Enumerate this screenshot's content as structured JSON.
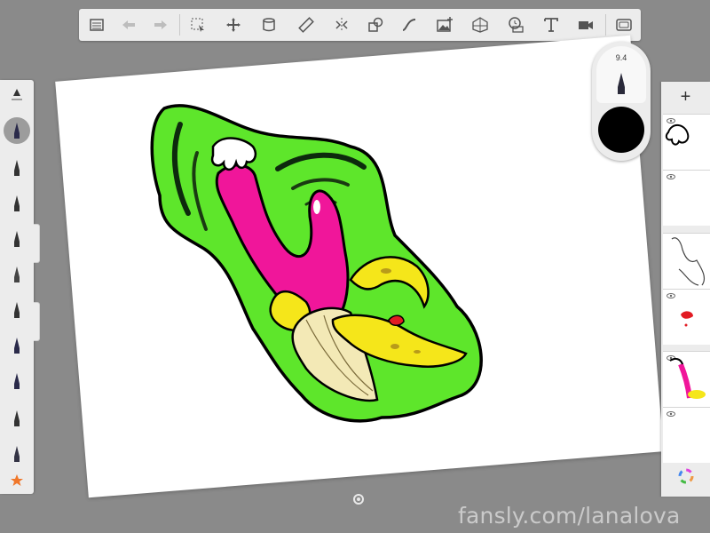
{
  "toolbar": {
    "buttons": [
      {
        "name": "layers-list-icon"
      },
      {
        "name": "undo-icon"
      },
      {
        "name": "redo-icon"
      },
      {
        "name": "selection-icon"
      },
      {
        "name": "transform-icon"
      },
      {
        "name": "fill-bucket-icon"
      },
      {
        "name": "ruler-icon"
      },
      {
        "name": "symmetry-icon"
      },
      {
        "name": "shape-icon"
      },
      {
        "name": "curve-icon"
      },
      {
        "name": "image-import-icon"
      },
      {
        "name": "perspective-icon"
      },
      {
        "name": "time-lapse-icon"
      },
      {
        "name": "text-icon"
      },
      {
        "name": "video-icon"
      },
      {
        "name": "fullscreen-icon"
      }
    ]
  },
  "brush_puck": {
    "size_label": "9.4",
    "color": "#000000"
  },
  "layers": {
    "add_label": "+",
    "items": [
      {
        "name": "layer-hand-sketch",
        "visible": true
      },
      {
        "name": "layer-empty",
        "visible": true
      },
      {
        "name": "layer-line-sketch",
        "visible": true
      },
      {
        "name": "layer-red-accent",
        "visible": true
      },
      {
        "name": "layer-color-art",
        "visible": true
      },
      {
        "name": "layer-blank",
        "visible": true
      }
    ]
  },
  "watermark": "fansly.com/lanalova",
  "colors": {
    "green": "#5ee62b",
    "pink": "#f0169a",
    "yellow": "#f5e61a",
    "cream": "#f3e9b6",
    "panel": "#ececec",
    "workspace": "#8a8a8a"
  }
}
